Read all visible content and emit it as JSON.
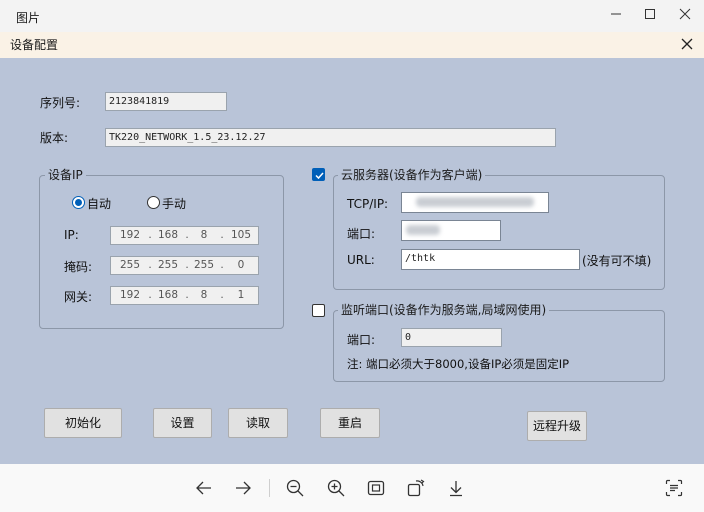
{
  "window": {
    "title": "图片"
  },
  "dialog": {
    "title": "设备配置",
    "serial_label": "序列号:",
    "serial_value": "2123841819",
    "version_label": "版本:",
    "version_value": "TK220_NETWORK_1.5_23.12.27",
    "device_ip": {
      "legend": "设备IP",
      "auto_label": "自动",
      "manual_label": "手动",
      "mode": "auto",
      "ip_label": "IP:",
      "mask_label": "掩码:",
      "gateway_label": "网关:",
      "ip": [
        "192",
        "168",
        "8",
        "105"
      ],
      "mask": [
        "255",
        "255",
        "255",
        "0"
      ],
      "gateway": [
        "192",
        "168",
        "8",
        "1"
      ]
    },
    "cloud": {
      "legend": "云服务器(设备作为客户端)",
      "checked": true,
      "tcp_label": "TCP/IP:",
      "port_label": "端口:",
      "url_label": "URL:",
      "url_value": "/thtk",
      "url_hint": "(没有可不填)"
    },
    "listen": {
      "legend": "监听端口(设备作为服务端,局域网使用)",
      "checked": false,
      "port_label": "端口:",
      "port_value": "0",
      "note": "注: 端口必须大于8000,设备IP必须是固定IP"
    },
    "buttons": {
      "init": "初始化",
      "set": "设置",
      "read": "读取",
      "restart": "重启",
      "upgrade": "远程升级"
    }
  },
  "toolbar_icons": [
    "arrow-left-icon",
    "arrow-right-icon",
    "zoom-out-icon",
    "zoom-in-icon",
    "fit-screen-icon",
    "rotate-icon",
    "download-icon",
    "ocr-icon"
  ],
  "colors": {
    "accent": "#005fb8",
    "dialog_bg": "#b9c4d8",
    "dialog_titlebar": "#faf2e6"
  }
}
